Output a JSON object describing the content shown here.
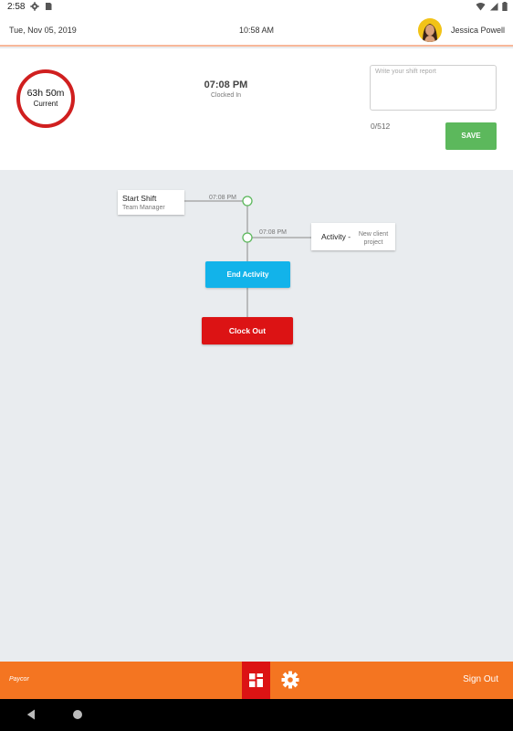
{
  "status_bar": {
    "time": "2:58"
  },
  "header": {
    "date": "Tue, Nov 05, 2019",
    "clock": "10:58 AM",
    "user_name": "Jessica Powell"
  },
  "summary": {
    "duration": "63h 50m",
    "duration_label": "Current",
    "clocked_in_time": "07:08 PM",
    "clocked_in_label": "Clocked In"
  },
  "report": {
    "placeholder": "Write your shift report",
    "counter": "0/512",
    "save_label": "SAVE"
  },
  "timeline": {
    "start": {
      "title": "Start Shift",
      "subtitle": "Team Manager",
      "time": "07:08 PM"
    },
    "activity": {
      "title": "Activity -",
      "detail": "New client project",
      "time": "07:08 PM"
    },
    "end_activity_label": "End Activity",
    "clock_out_label": "Clock Out"
  },
  "footer": {
    "brand": "Paycor",
    "sign_out_label": "Sign Out"
  },
  "colors": {
    "accent": "#f47521",
    "clock_out": "#dc1314",
    "end_activity": "#12b3ea",
    "save": "#5cb85c",
    "ring": "#d01f1f",
    "node": "#5cb85c"
  },
  "icons": [
    "settings-icon",
    "sim-icon",
    "wifi-icon",
    "battery-icon",
    "dashboard-icon",
    "gear-icon",
    "back-icon",
    "home-icon"
  ]
}
